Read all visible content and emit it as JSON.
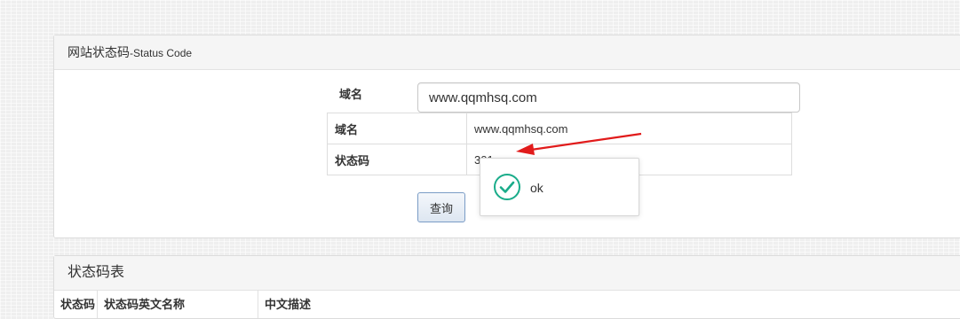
{
  "panel1": {
    "title": "网站状态码",
    "title_sub": "-Status Code",
    "domain_label": "域名",
    "domain_value": "www.qqmhsq.com",
    "result_rows": [
      {
        "key": "域名",
        "value": "www.qqmhsq.com"
      },
      {
        "key": "状态码",
        "value": "301"
      }
    ],
    "query_button": "查询"
  },
  "toast": {
    "icon": "check-circle-icon",
    "message": "ok",
    "accent_color": "#1aac8a"
  },
  "annotation": {
    "icon": "red-arrow",
    "color": "#e11b1b"
  },
  "panel2": {
    "title": "状态码表",
    "columns": [
      "状态码",
      "状态码英文名称",
      "中文描述"
    ]
  }
}
